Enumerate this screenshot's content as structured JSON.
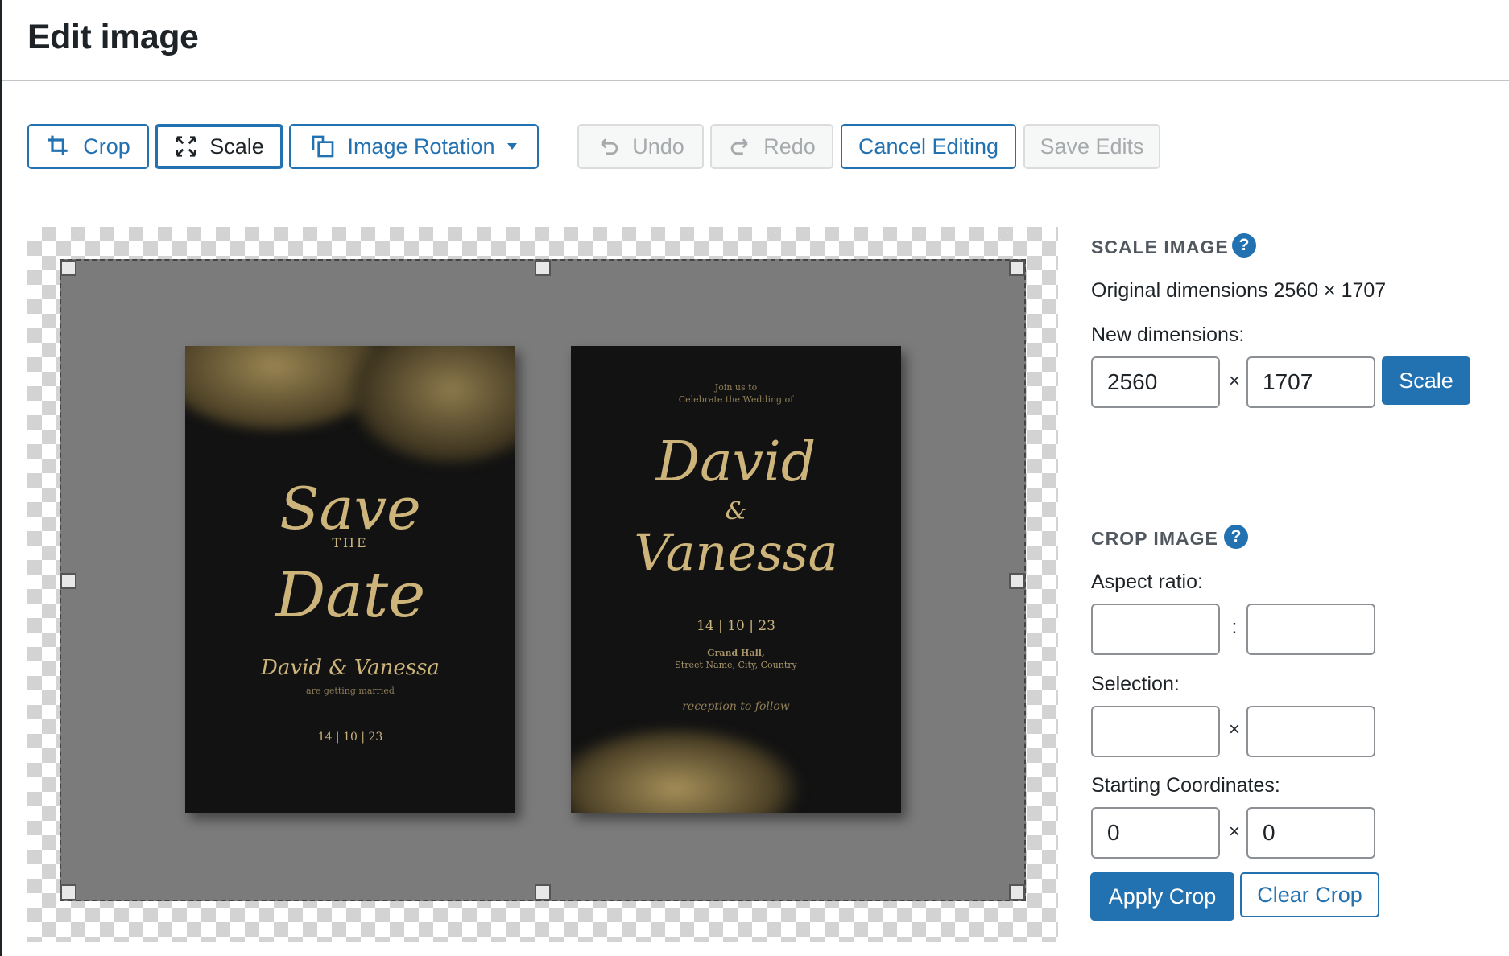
{
  "page": {
    "title": "Edit image"
  },
  "toolbar": {
    "crop_label": "Crop",
    "scale_label": "Scale",
    "rotation_label": "Image Rotation",
    "undo_label": "Undo",
    "redo_label": "Redo",
    "cancel_label": "Cancel Editing",
    "save_label": "Save Edits"
  },
  "image": {
    "card_left": {
      "line1": "Save",
      "line2": "THE",
      "line3": "Date",
      "names": "David & Vanessa",
      "subtitle": "are getting married",
      "date": "14 | 10 | 23"
    },
    "card_right": {
      "intro1": "Join us to",
      "intro2": "Celebrate the Wedding of",
      "name1": "David",
      "amp": "&",
      "name2": "Vanessa",
      "date": "14 | 10 | 23",
      "venue": "Grand Hall,",
      "address": "Street Name, City, Country",
      "footer": "reception to follow"
    }
  },
  "scale": {
    "section_title": "SCALE IMAGE",
    "help_glyph": "?",
    "original_dimensions": "Original dimensions 2560 × 1707",
    "new_dimensions_label": "New dimensions:",
    "width_value": "2560",
    "height_value": "1707",
    "times": "×",
    "button_label": "Scale"
  },
  "crop": {
    "section_title": "CROP IMAGE",
    "help_glyph": "?",
    "aspect_label": "Aspect ratio:",
    "aspect_sep": ":",
    "aspect_w": "",
    "aspect_h": "",
    "selection_label": "Selection:",
    "selection_sep": "×",
    "selection_w": "",
    "selection_h": "",
    "start_label": "Starting Coordinates:",
    "start_sep": "×",
    "start_x": "0",
    "start_y": "0",
    "apply_label": "Apply Crop",
    "clear_label": "Clear Crop"
  },
  "colors": {
    "accent": "#2271b1",
    "text": "#1d2327",
    "muted": "#50575e",
    "disabled": "#a7aaad",
    "gold": "#c9b27b"
  }
}
